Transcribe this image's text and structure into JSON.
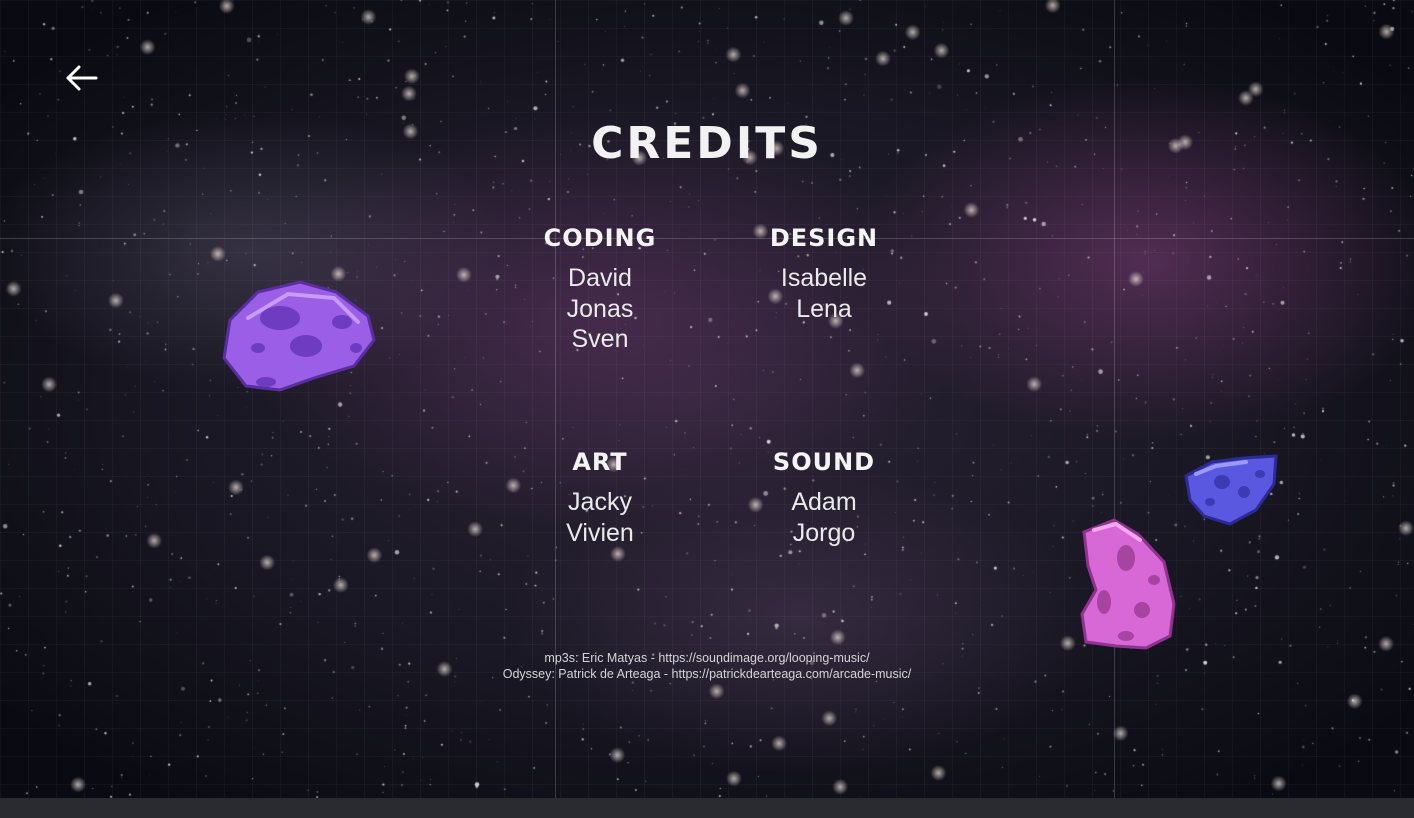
{
  "screen": {
    "title": "CREDITS",
    "back_icon": "arrow-left-icon"
  },
  "sections": [
    {
      "heading": "CODING",
      "names": [
        "David",
        "Jonas",
        "Sven"
      ]
    },
    {
      "heading": "DESIGN",
      "names": [
        "Isabelle",
        "Lena"
      ]
    },
    {
      "heading": "ART",
      "names": [
        "Jacky",
        "Vivien"
      ]
    },
    {
      "heading": "SOUND",
      "names": [
        "Adam",
        "Jorgo"
      ]
    }
  ],
  "attribution": {
    "line1": "mp3s: Eric Matyas - https://soundimage.org/looping-music/",
    "line2": "Odyssey: Patrick de Arteaga - https://patrickdearteaga.com/arcade-music/"
  },
  "colors": {
    "asteroid_left": "#9b5ee6",
    "asteroid_pink": "#d868d6",
    "asteroid_blue": "#5a58e0",
    "text": "#f2f2f2"
  }
}
